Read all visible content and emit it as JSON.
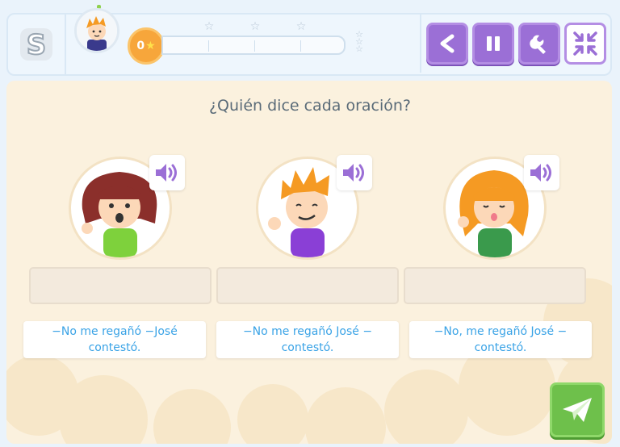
{
  "app": {
    "logo_letter": "S"
  },
  "header": {
    "score_value": "0",
    "score_star": "★",
    "progress_stars": [
      "☆",
      "☆",
      "☆"
    ],
    "progress_fraction": 0,
    "toolbar": {
      "back_icon": "back-arrow-icon",
      "pause_icon": "pause-icon",
      "settings_icon": "wrench-icon",
      "fullscreen_icon": "collapse-arrows-icon"
    }
  },
  "exercise": {
    "question": "¿Quién dice cada oración?",
    "characters": [
      {
        "name": "girl-brown-hair",
        "sound_icon": "speaker-icon"
      },
      {
        "name": "boy-orange-hair",
        "sound_icon": "speaker-icon"
      },
      {
        "name": "girl-orange-hair",
        "sound_icon": "speaker-icon"
      }
    ],
    "answers": [
      "−No me regañó −José contestó.",
      "−No me regañó José − contestó.",
      "−No, me regañó José − contestó."
    ],
    "send_icon": "paper-plane-icon"
  },
  "colors": {
    "accent_purple": "#9b6fd6",
    "score_orange": "#f7a63b",
    "send_green": "#6ec04b",
    "answer_text_blue": "#3aa3e6",
    "panel_background": "#fbf1de"
  }
}
